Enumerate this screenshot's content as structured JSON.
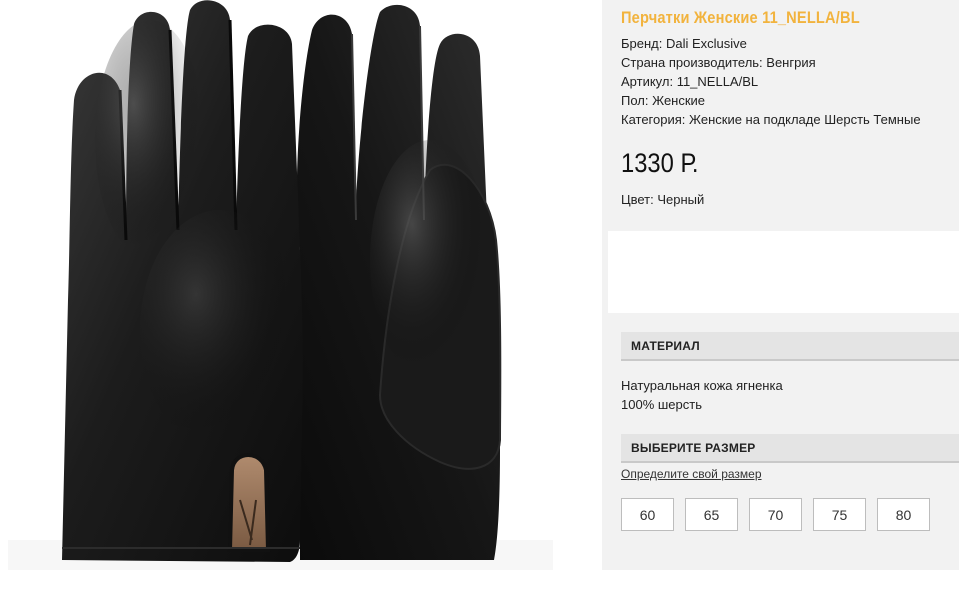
{
  "product": {
    "title": "Перчатки Женские 11_NELLA/BL",
    "brand": "Бренд: Dali Exclusive",
    "country": "Страна производитель: Венгрия",
    "article": "Артикул: 11_NELLA/BL",
    "gender": "Пол: Женские",
    "category": "Категория: Женские на подкладе Шерсть Темные",
    "price": "1330 Р.",
    "color": "Цвет: Черный"
  },
  "material": {
    "heading": "МАТЕРИАЛ",
    "line1": "Натуральная кожа ягненка",
    "line2": "100% шерсть"
  },
  "size_select": {
    "heading": "ВЫБЕРИТЕ РАЗМЕР",
    "link": "Определите свой размер",
    "options": [
      "60",
      "65",
      "70",
      "75",
      "80"
    ]
  },
  "image": {
    "subject": "black-leather-gloves",
    "accent_color": "#f2b33d"
  }
}
